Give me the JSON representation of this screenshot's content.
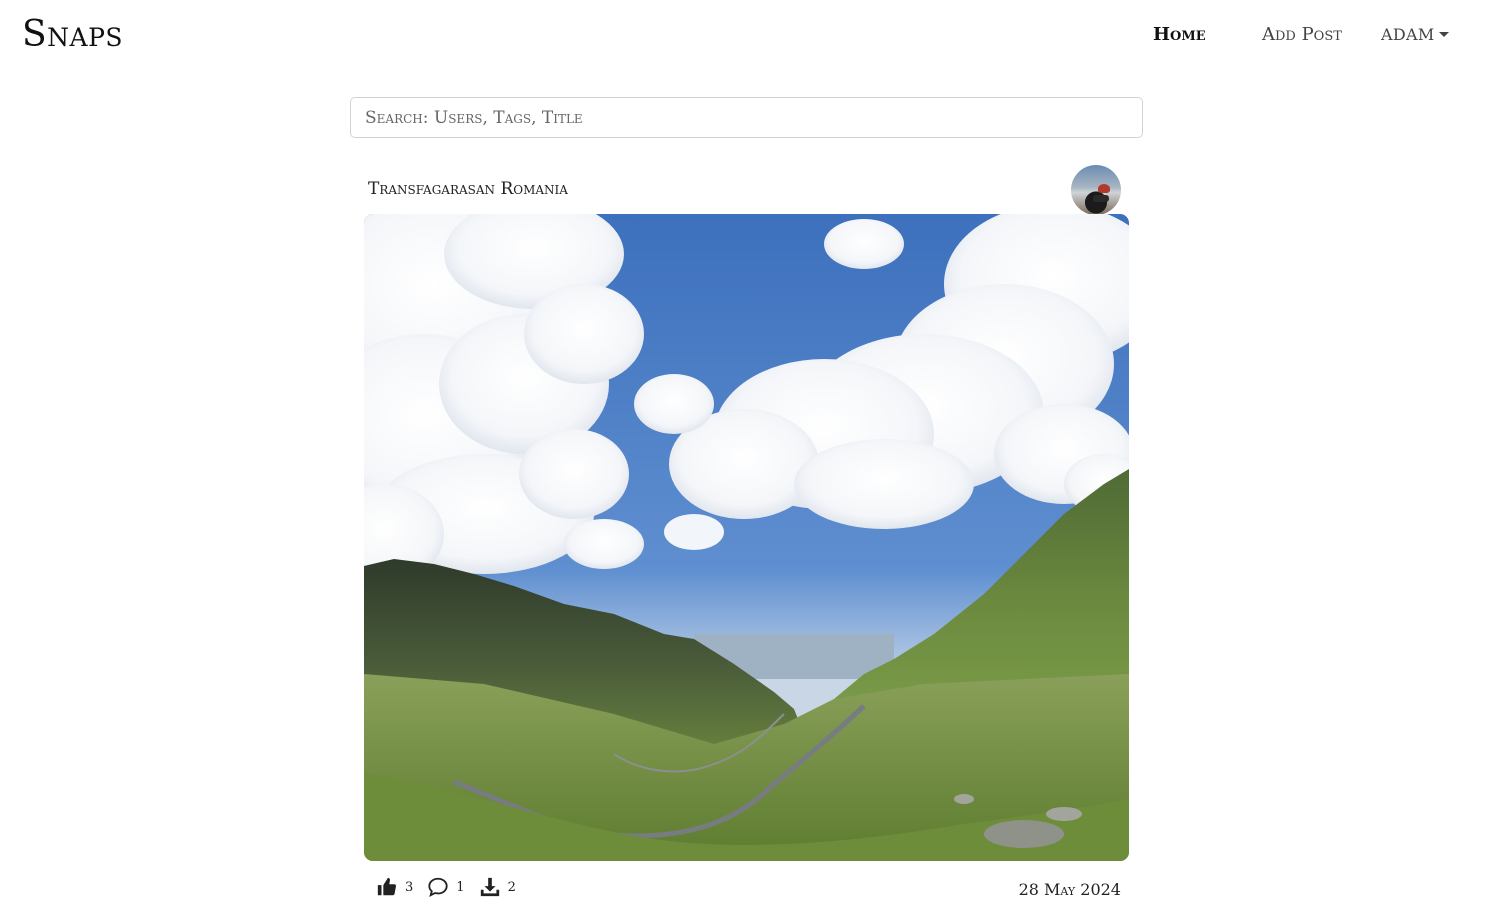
{
  "nav": {
    "brand": "Snaps",
    "home_label": "Home",
    "add_post_label": "Add Post",
    "user_label": "ADAM"
  },
  "search": {
    "placeholder": "Search: Users, Tags, Title",
    "value": ""
  },
  "post": {
    "title": "Transfagarasan Romania",
    "likes": "3",
    "comments": "1",
    "downloads": "2",
    "date": "28 May 2024"
  },
  "icons": {
    "like": "thumbs-up-icon",
    "comment": "comment-icon",
    "download": "download-icon",
    "dropdown": "caret-down-icon"
  },
  "colors": {
    "text": "#222222",
    "border": "#d0d4d8",
    "sky": "#4c7fc4"
  }
}
